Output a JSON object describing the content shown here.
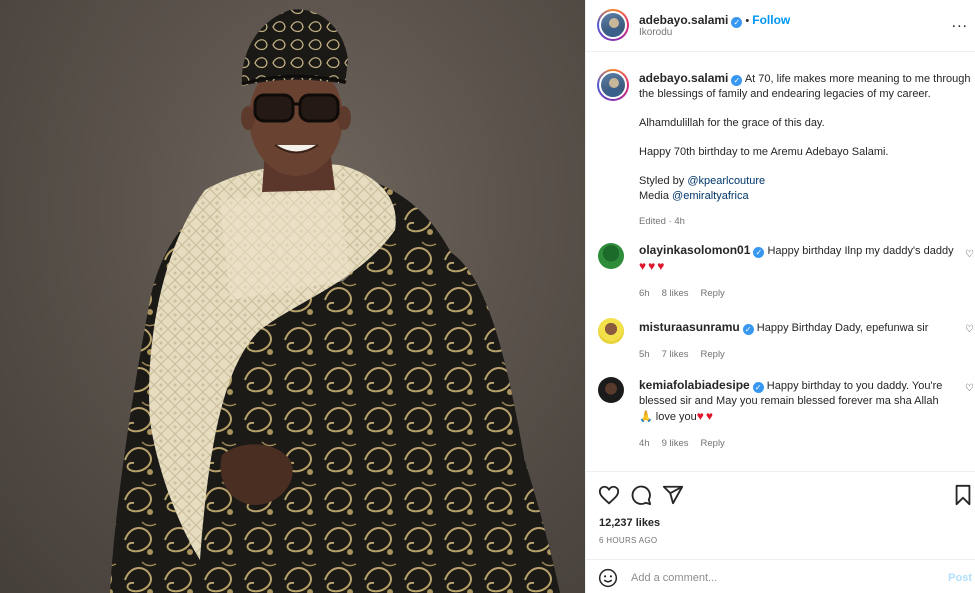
{
  "post": {
    "username": "adebayo.salami",
    "location": "Ikorodu",
    "follow_label": "Follow",
    "dot": "•",
    "more_label": "...",
    "caption": {
      "line1": "At 70, life makes more meaning to me through the blessings of family and endearing legacies of my career.",
      "line2": "Alhamdulillah for the grace of this day.",
      "line3": "Happy 70th birthday to me Aremu Adebayo Salami.",
      "styled_by_prefix": "Styled by ",
      "styled_by_mention": "@kpearlcouture",
      "media_prefix": "Media ",
      "media_mention": "@emiraltyafrica",
      "edited": "Edited · 4h"
    },
    "likes": "12,237 likes",
    "time_ago": "6 HOURS AGO",
    "add_comment_placeholder": "Add a comment...",
    "post_label": "Post"
  },
  "comments": [
    {
      "username": "olayinkasolomon01",
      "text": "Happy birthday Ilnp my daddy's daddy",
      "hearts": "♥♥♥",
      "time": "6h",
      "likes": "8 likes",
      "reply": "Reply"
    },
    {
      "username": "misturaasunramu",
      "text": "Happy Birthday Dady, epefunwa sir",
      "time": "5h",
      "likes": "7 likes",
      "reply": "Reply"
    },
    {
      "username": "kemiafolabiadesipe",
      "text": "Happy birthday to you daddy. You're blessed sir and May you remain blessed forever ma sha Allah",
      "text2": "love you",
      "hearts": "♥♥",
      "pray": "🙏",
      "time": "4h",
      "likes": "9 likes",
      "reply": "Reply"
    }
  ],
  "icons": {
    "verified": "✓",
    "heart": "♡",
    "comment": "comment-icon",
    "share": "share-icon",
    "bookmark": "bookmark-icon",
    "emoji": "emoji-icon"
  },
  "colors": {
    "link_blue": "#0095f6",
    "mention": "#00376b",
    "heart_red": "#e0162b"
  }
}
